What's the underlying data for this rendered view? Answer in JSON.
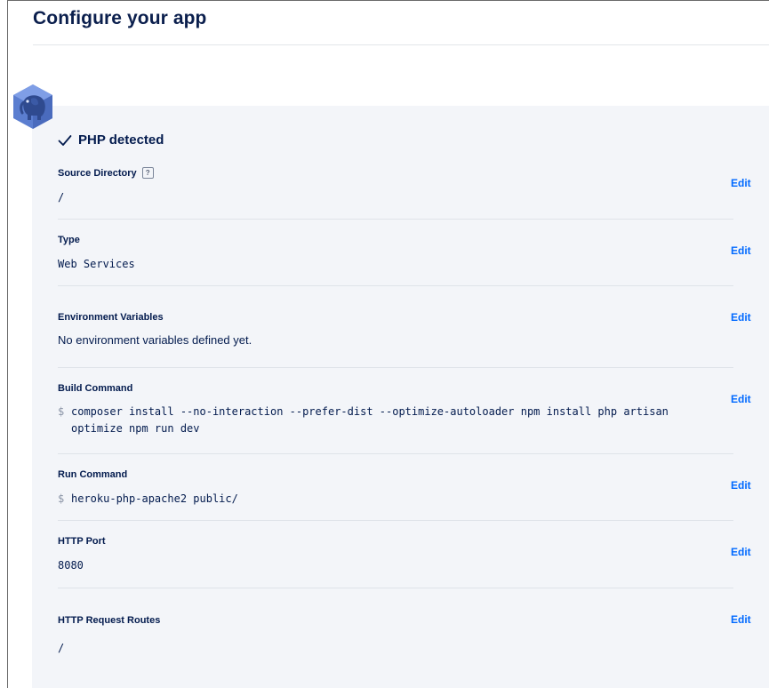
{
  "page": {
    "title": "Configure your app"
  },
  "component": {
    "detected_label": "PHP detected",
    "icon": "php-elephant-icon"
  },
  "sections": [
    {
      "label": "Source Directory",
      "help": "?",
      "value": "/",
      "edit": "Edit"
    },
    {
      "label": "Type",
      "value": "Web Services",
      "edit": "Edit"
    },
    {
      "label": "Environment Variables",
      "value": "No environment variables defined yet.",
      "edit": "Edit"
    },
    {
      "label": "Build Command",
      "prompt": "$",
      "value": "composer install --no-interaction --prefer-dist --optimize-autoloader npm install php artisan optimize npm run dev",
      "edit": "Edit"
    },
    {
      "label": "Run Command",
      "prompt": "$",
      "value": "heroku-php-apache2 public/",
      "edit": "Edit"
    },
    {
      "label": "HTTP Port",
      "value": "8080",
      "edit": "Edit"
    },
    {
      "label": "HTTP Request Routes",
      "value": "/",
      "edit": "Edit"
    }
  ],
  "colors": {
    "link": "#0069ff",
    "panel_background": "#f3f5f9",
    "heading": "#031b4e"
  }
}
